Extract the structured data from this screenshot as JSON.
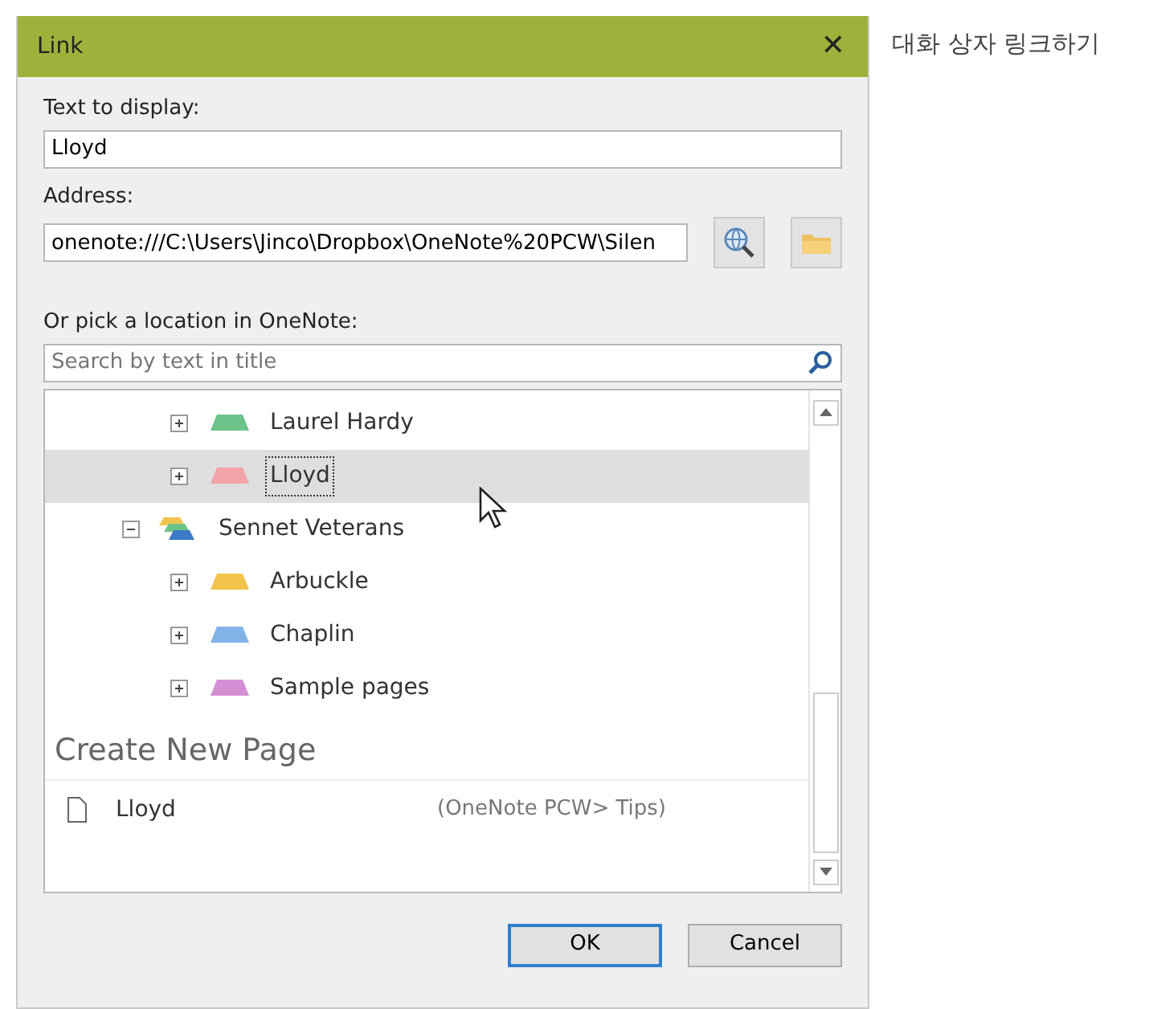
{
  "caption": "대화 상자 링크하기",
  "window": {
    "title": "Link",
    "close": "✕"
  },
  "text_to_display": {
    "label": "Text to display:",
    "value": "Lloyd"
  },
  "address": {
    "label": "Address:",
    "value": "onenote:///C:\\Users\\Jinco\\Dropbox\\OneNote%20PCW\\Silen"
  },
  "pick": {
    "label": "Or pick a location in OneNote:",
    "placeholder": "Search by text in title"
  },
  "tree": [
    {
      "label": "Laurel Hardy",
      "kind": "section",
      "color": "#6cc38a",
      "selected": false
    },
    {
      "label": "Lloyd",
      "kind": "section",
      "color": "#f4a3aa",
      "selected": true
    },
    {
      "label": "Sennet Veterans",
      "kind": "notebook",
      "expanded": true,
      "selected": false,
      "children": [
        {
          "label": "Arbuckle",
          "kind": "section",
          "color": "#f2c44c",
          "selected": false
        },
        {
          "label": "Chaplin",
          "kind": "section",
          "color": "#82b3e6",
          "selected": false
        },
        {
          "label": "Sample pages",
          "kind": "section",
          "color": "#d38fd3",
          "selected": false
        }
      ]
    }
  ],
  "create_new_page": {
    "heading": "Create New Page",
    "page": "Lloyd",
    "location": "(OneNote PCW> Tips)"
  },
  "buttons": [
    {
      "label": "OK",
      "default": true
    },
    {
      "label": "Cancel",
      "default": false
    }
  ]
}
